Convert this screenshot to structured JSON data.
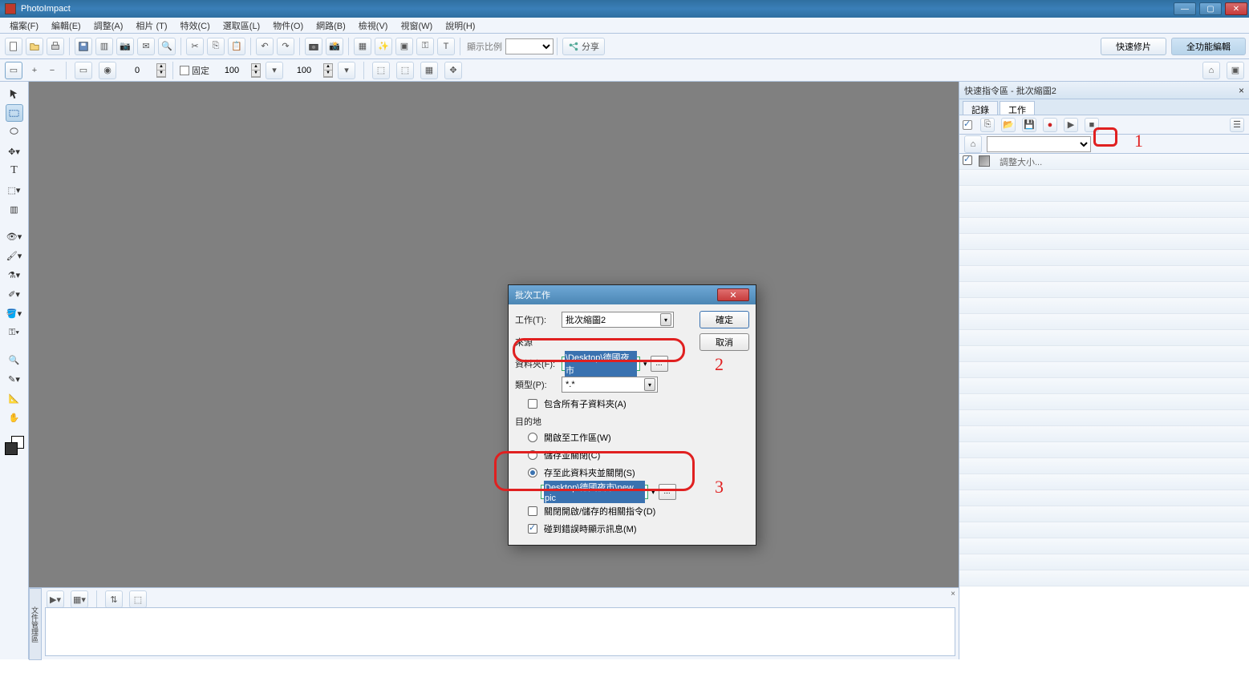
{
  "titlebar": {
    "app": "PhotoImpact"
  },
  "menubar": {
    "items": [
      "檔案(F)",
      "編輯(E)",
      "調整(A)",
      "相片 (T)",
      "特效(C)",
      "選取區(L)",
      "物件(O)",
      "網路(B)",
      "檢視(V)",
      "視窗(W)",
      "說明(H)"
    ]
  },
  "toolbar": {
    "display_ratio": "顯示比例",
    "share": "分享",
    "mode_quick": "快速修片",
    "mode_full": "全功能編輯"
  },
  "options": {
    "fixed": "固定",
    "w": "100",
    "h": "100",
    "zero": "0"
  },
  "sidepanel": {
    "title": "快速指令區 - 批次縮圖2",
    "tabs": {
      "record": "記錄",
      "task": "工作"
    },
    "list_item": "調整大小..."
  },
  "dialog": {
    "title": "批次工作",
    "task_label": "工作(T):",
    "task_value": "批次縮圖2",
    "ok": "確定",
    "cancel": "取消",
    "source_group": "來源",
    "folder_label": "資料夾(F):",
    "folder_value": "\\Desktop\\德國夜市",
    "type_label": "類型(P):",
    "type_value": "*.*",
    "include_sub": "包含所有子資料夾(A)",
    "dest_group": "目的地",
    "open_workspace": "開啟至工作區(W)",
    "save_close": "儲存並關閉(C)",
    "save_folder_close": "存至此資料夾並關閉(S)",
    "dest_value": "Desktop\\德國夜市\\new pic",
    "close_open_cmds": "關閉開啟/儲存的相關指令(D)",
    "show_error": "碰到錯誤時顯示訊息(M)"
  },
  "filmstrip": {
    "tab": "文件管理區"
  },
  "anno": {
    "n1": "1",
    "n2": "2",
    "n3": "3"
  }
}
